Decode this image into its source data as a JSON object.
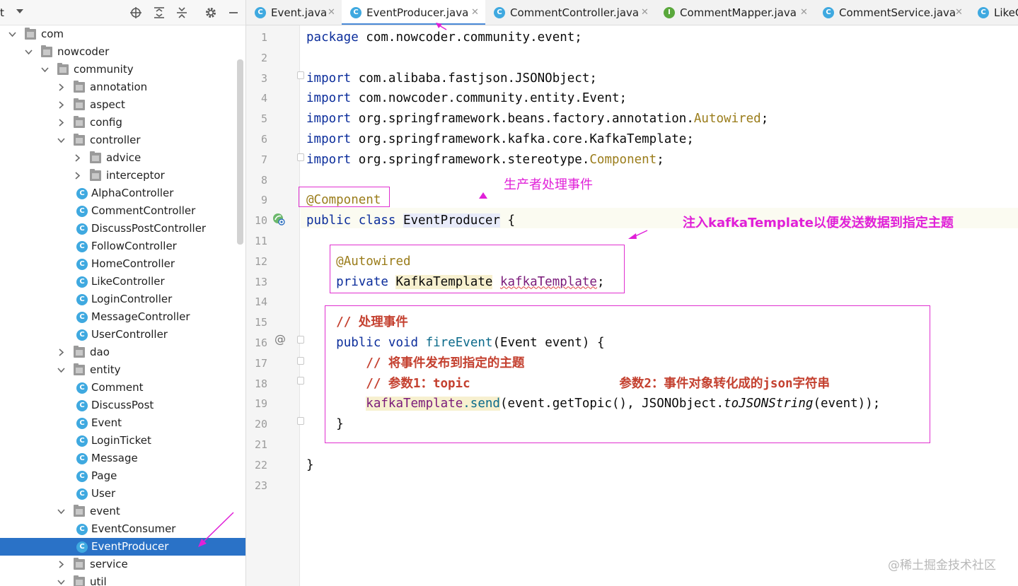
{
  "project_panel": {
    "title": "t",
    "tree": [
      {
        "label": "com",
        "type": "folder",
        "expanded": true,
        "depth": 0
      },
      {
        "label": "nowcoder",
        "type": "folder",
        "expanded": true,
        "depth": 1
      },
      {
        "label": "community",
        "type": "folder",
        "expanded": true,
        "depth": 2
      },
      {
        "label": "annotation",
        "type": "folder",
        "expanded": false,
        "depth": 3
      },
      {
        "label": "aspect",
        "type": "folder",
        "expanded": false,
        "depth": 3
      },
      {
        "label": "config",
        "type": "folder",
        "expanded": false,
        "depth": 3
      },
      {
        "label": "controller",
        "type": "folder",
        "expanded": true,
        "depth": 3
      },
      {
        "label": "advice",
        "type": "folder",
        "expanded": false,
        "depth": 4
      },
      {
        "label": "interceptor",
        "type": "folder",
        "expanded": false,
        "depth": 4
      },
      {
        "label": "AlphaController",
        "type": "class",
        "depth": 4
      },
      {
        "label": "CommentController",
        "type": "class",
        "depth": 4
      },
      {
        "label": "DiscussPostController",
        "type": "class",
        "depth": 4
      },
      {
        "label": "FollowController",
        "type": "class",
        "depth": 4
      },
      {
        "label": "HomeController",
        "type": "class",
        "depth": 4
      },
      {
        "label": "LikeController",
        "type": "class",
        "depth": 4
      },
      {
        "label": "LoginController",
        "type": "class",
        "depth": 4
      },
      {
        "label": "MessageController",
        "type": "class",
        "depth": 4
      },
      {
        "label": "UserController",
        "type": "class",
        "depth": 4
      },
      {
        "label": "dao",
        "type": "folder",
        "expanded": false,
        "depth": 3
      },
      {
        "label": "entity",
        "type": "folder",
        "expanded": true,
        "depth": 3
      },
      {
        "label": "Comment",
        "type": "class",
        "depth": 4
      },
      {
        "label": "DiscussPost",
        "type": "class",
        "depth": 4
      },
      {
        "label": "Event",
        "type": "class",
        "depth": 4
      },
      {
        "label": "LoginTicket",
        "type": "class",
        "depth": 4
      },
      {
        "label": "Message",
        "type": "class",
        "depth": 4
      },
      {
        "label": "Page",
        "type": "class",
        "depth": 4
      },
      {
        "label": "User",
        "type": "class",
        "depth": 4
      },
      {
        "label": "event",
        "type": "folder",
        "expanded": true,
        "depth": 3
      },
      {
        "label": "EventConsumer",
        "type": "class",
        "depth": 4
      },
      {
        "label": "EventProducer",
        "type": "class",
        "depth": 4,
        "selected": true
      },
      {
        "label": "service",
        "type": "folder",
        "expanded": false,
        "depth": 3
      },
      {
        "label": "util",
        "type": "folder",
        "expanded": true,
        "depth": 3
      }
    ]
  },
  "tabs": [
    {
      "label": "Event.java",
      "icon": "C",
      "active": false
    },
    {
      "label": "EventProducer.java",
      "icon": "C",
      "active": true
    },
    {
      "label": "CommentController.java",
      "icon": "C",
      "active": false
    },
    {
      "label": "CommentMapper.java",
      "icon": "I",
      "active": false
    },
    {
      "label": "CommentService.java",
      "icon": "C",
      "active": false
    },
    {
      "label": "LikeC",
      "icon": "C",
      "active": false
    }
  ],
  "line_numbers": [
    "1",
    "2",
    "3",
    "4",
    "5",
    "6",
    "7",
    "8",
    "9",
    "10",
    "11",
    "12",
    "13",
    "14",
    "15",
    "16",
    "17",
    "18",
    "19",
    "20",
    "21",
    "22",
    "23"
  ],
  "code": [
    [
      {
        "t": "package ",
        "c": "kw"
      },
      {
        "t": "com.nowcoder.community.event;"
      }
    ],
    [],
    [
      {
        "t": "import ",
        "c": "kw"
      },
      {
        "t": "com.alibaba.fastjson.JSONObject;"
      }
    ],
    [
      {
        "t": "import ",
        "c": "kw"
      },
      {
        "t": "com.nowcoder.community.entity.Event;"
      }
    ],
    [
      {
        "t": "import ",
        "c": "kw"
      },
      {
        "t": "org.springframework.beans.factory.annotation."
      },
      {
        "t": "Autowired",
        "c": "ann"
      },
      {
        "t": ";"
      }
    ],
    [
      {
        "t": "import ",
        "c": "kw"
      },
      {
        "t": "org.springframework.kafka.core.KafkaTemplate;"
      }
    ],
    [
      {
        "t": "import ",
        "c": "kw"
      },
      {
        "t": "org.springframework.stereotype."
      },
      {
        "t": "Component",
        "c": "ann"
      },
      {
        "t": ";"
      }
    ],
    [],
    [
      {
        "t": "@Component",
        "c": "ann"
      }
    ],
    [
      {
        "t": "public ",
        "c": "kw"
      },
      {
        "t": "class ",
        "c": "kw"
      },
      {
        "t": "EventProducer",
        "c": "hl-blue"
      },
      {
        "t": " {"
      }
    ],
    [],
    [
      {
        "t": "    "
      },
      {
        "t": "@Autowired",
        "c": "ann"
      }
    ],
    [
      {
        "t": "    "
      },
      {
        "t": "private ",
        "c": "kw"
      },
      {
        "t": "KafkaTemplate",
        "c": "hl-yellow"
      },
      {
        "t": " "
      },
      {
        "t": "kafkaTemplate",
        "c": "field squiggle"
      },
      {
        "t": ";"
      }
    ],
    [],
    [
      {
        "t": "    "
      },
      {
        "t": "// 处理事件",
        "c": "cm"
      }
    ],
    [
      {
        "t": "    "
      },
      {
        "t": "public ",
        "c": "kw"
      },
      {
        "t": "void ",
        "c": "kw"
      },
      {
        "t": "fireEvent",
        "c": "fn"
      },
      {
        "t": "(Event event) {"
      }
    ],
    [
      {
        "t": "        "
      },
      {
        "t": "// 将事件发布到指定的主题",
        "c": "cm"
      }
    ],
    [
      {
        "t": "        "
      },
      {
        "t": "// 参数1：topic                    参数2：事件对象转化成的json字符串",
        "c": "cm"
      }
    ],
    [
      {
        "t": "        "
      },
      {
        "t": "kafkaTemplate",
        "c": "field hl-yellow"
      },
      {
        "t": ".send",
        "c": "hl-yellow fn"
      },
      {
        "t": "(event.getTopic(), JSONObject."
      },
      {
        "t": "toJSONString",
        "c": "it"
      },
      {
        "t": "(event));"
      }
    ],
    [
      {
        "t": "    }"
      }
    ],
    [],
    [
      {
        "t": "}"
      }
    ],
    []
  ],
  "annotations": {
    "note_producer": "生产者处理事件",
    "note_inject": "注入kafkaTemplate以便发送数据到指定主题"
  },
  "watermark": "@稀土掘金技术社区",
  "colors": {
    "accent": "#2a72c7",
    "annotation": "#e020d8",
    "keyword": "#0b2d9b",
    "comment": "#c4402f",
    "annotation_code": "#9a7c1a"
  }
}
